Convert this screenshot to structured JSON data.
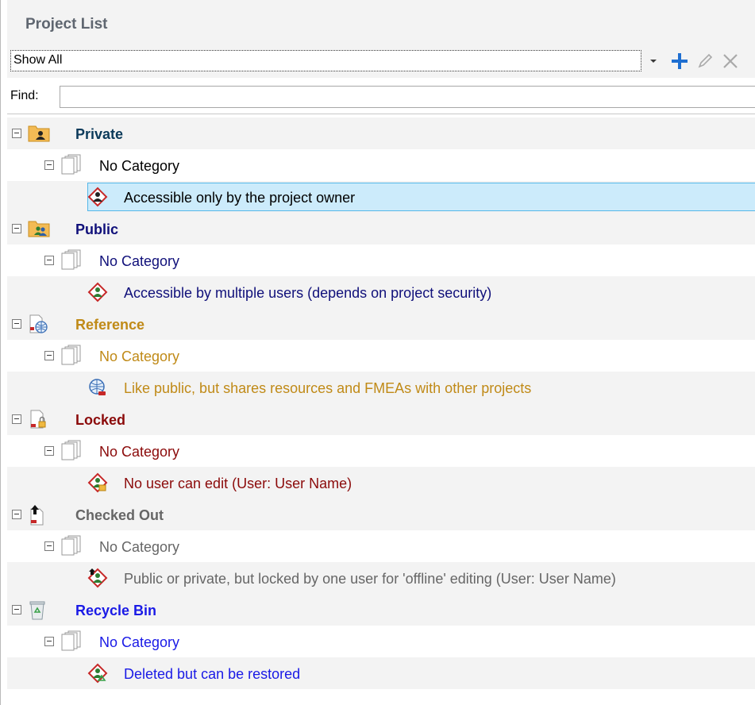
{
  "panel": {
    "title": "Project List"
  },
  "toolbar": {
    "filter_value": "Show All",
    "dropdown_icon": "chevron-down-icon",
    "add_icon": "plus-icon",
    "edit_icon": "pencil-icon",
    "delete_icon": "close-icon"
  },
  "find": {
    "label": "Find:",
    "value": ""
  },
  "groups": [
    {
      "name": "Private",
      "color": "#0b3a5a",
      "category": "No Category",
      "item": "Accessible only by the project owner",
      "item_color": "#000000",
      "icon": "private-folder-icon",
      "item_icon": "private-project-icon"
    },
    {
      "name": "Public",
      "color": "#10107a",
      "category": "No Category",
      "item": "Accessible by multiple users (depends on project security)",
      "item_color": "#10107a",
      "icon": "public-folder-icon",
      "item_icon": "public-project-icon"
    },
    {
      "name": "Reference",
      "color": "#c08a17",
      "category": "No Category",
      "item": "Like public, but shares resources and FMEAs with other projects",
      "item_color": "#c08a17",
      "icon": "reference-globe-icon",
      "item_icon": "reference-project-icon"
    },
    {
      "name": "Locked",
      "color": "#8b0a0a",
      "category": "No Category",
      "item": "No user can edit (User: User Name)",
      "item_color": "#8b0a0a",
      "icon": "locked-document-icon",
      "item_icon": "locked-project-icon"
    },
    {
      "name": "Checked Out",
      "color": "#666666",
      "category": "No Category",
      "item": "Public or private, but locked by one user for 'offline' editing (User: User Name)",
      "item_color": "#666666",
      "icon": "checked-out-document-icon",
      "item_icon": "checked-out-project-icon"
    },
    {
      "name": "Recycle Bin",
      "color": "#1a1ae6",
      "category": "No Category",
      "item": "Deleted but can be restored",
      "item_color": "#1a1ae6",
      "icon": "recycle-bin-icon",
      "item_icon": "deleted-project-icon"
    }
  ],
  "colors": {
    "selection": "#ccebfb",
    "selection_border": "#55b7e8",
    "accent_plus": "#1f6fd1"
  }
}
